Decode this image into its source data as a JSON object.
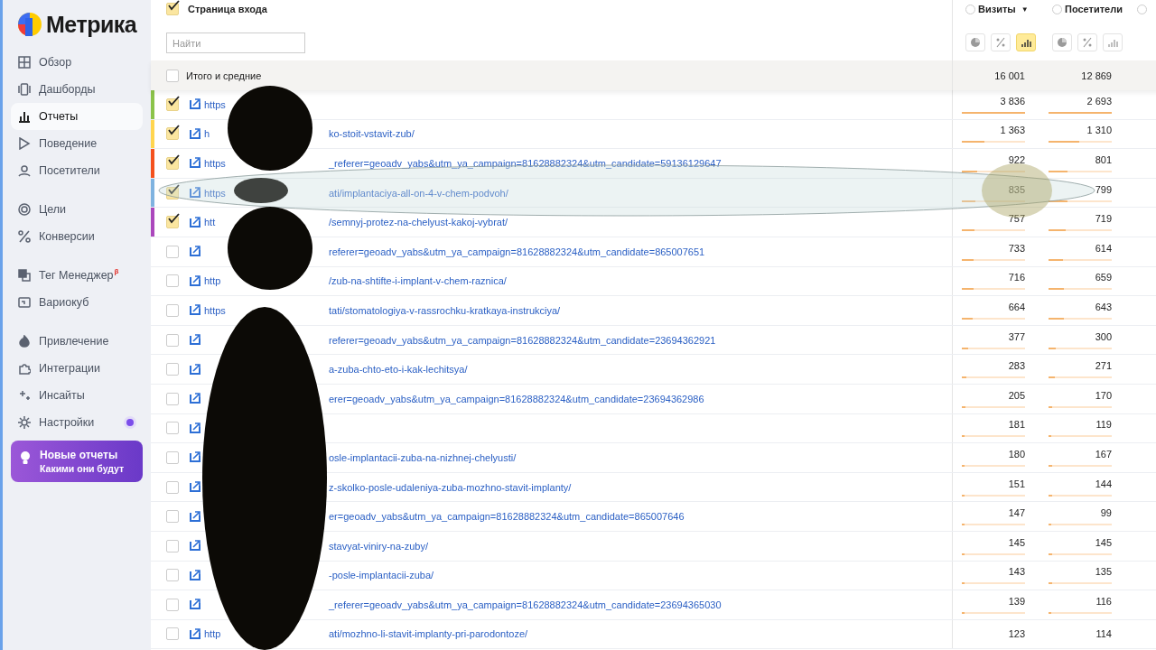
{
  "sidebar": {
    "logo_text": "Метрика",
    "groups": [
      [
        {
          "label": "Обзор",
          "selected": false,
          "notification": false
        },
        {
          "label": "Дашборды",
          "selected": false,
          "notification": false
        },
        {
          "label": "Отчеты",
          "selected": true,
          "notification": false
        },
        {
          "label": "Поведение",
          "selected": false,
          "notification": false
        },
        {
          "label": "Посетители",
          "selected": false,
          "notification": false
        }
      ],
      [
        {
          "label": "Цели",
          "selected": false,
          "notification": false
        },
        {
          "label": "Конверсии",
          "selected": false,
          "notification": false
        }
      ],
      [
        {
          "label": "Тег Менеджер",
          "badge": "β",
          "selected": false,
          "notification": false
        },
        {
          "label": "Вариокуб",
          "selected": false,
          "notification": false
        }
      ],
      [
        {
          "label": "Привлечение",
          "selected": false,
          "notification": false
        },
        {
          "label": "Интеграции",
          "selected": false,
          "notification": false
        },
        {
          "label": "Инсайты",
          "selected": false,
          "notification": false
        },
        {
          "label": "Настройки",
          "selected": false,
          "notification": true
        }
      ]
    ],
    "promo": {
      "title": "Новые отчеты",
      "subtitle": "Какими они будут"
    }
  },
  "report": {
    "dimension": {
      "label": "Страница входа",
      "checked": true
    },
    "search": {
      "placeholder": "Найти"
    },
    "columns": [
      {
        "label": "Визиты",
        "sort_mark": "▼",
        "views": [
          {
            "selected": false
          },
          {
            "selected": false
          },
          {
            "selected": true
          }
        ]
      },
      {
        "label": "Посетители",
        "views": [
          {
            "selected": false
          },
          {
            "selected": false
          },
          {
            "selected": false
          }
        ]
      }
    ],
    "totals": {
      "label": "Итого и средние",
      "checked": false,
      "values": [
        "16 001",
        "12 869"
      ]
    },
    "rows": [
      {
        "checked": true,
        "color": "#8bc34a",
        "url_prefix": "https",
        "url_suffix": "",
        "visits": {
          "value": "3 836",
          "level": 1
        },
        "visitors": {
          "value": "2 693",
          "level": 1
        }
      },
      {
        "checked": true,
        "color": "#ffd54f",
        "url_prefix": "h",
        "url_suffix": "ko-stoit-vstavit-zub/",
        "visits": {
          "value": "1 363",
          "level": 0.355
        },
        "visitors": {
          "value": "1 310",
          "level": 0.486
        }
      },
      {
        "checked": true,
        "color": "#f4511e",
        "url_prefix": "https",
        "url_suffix": "_referer=geoadv_yabs&utm_ya_campaign=81628882324&utm_candidate=59136129647",
        "visits": {
          "value": "922",
          "level": 0.24
        },
        "visitors": {
          "value": "801",
          "level": 0.297
        }
      },
      {
        "checked": true,
        "color": "#7fb3e0",
        "url_prefix": "https",
        "url_suffix": "ati/implantaciya-all-on-4-v-chem-podvoh/",
        "visits": {
          "value": "835",
          "level": 0.218
        },
        "visitors": {
          "value": "799",
          "level": 0.297
        }
      },
      {
        "checked": true,
        "color": "#ab47bc",
        "url_prefix": "htt",
        "url_suffix": "/semnyj-protez-na-chelyust-kakoj-vybrat/",
        "visits": {
          "value": "757",
          "level": 0.197
        },
        "visitors": {
          "value": "719",
          "level": 0.267
        }
      },
      {
        "checked": false,
        "url_prefix": "",
        "url_suffix": "referer=geoadv_yabs&utm_ya_campaign=81628882324&utm_candidate=865007651",
        "visits": {
          "value": "733",
          "level": 0.191
        },
        "visitors": {
          "value": "614",
          "level": 0.228
        }
      },
      {
        "checked": false,
        "url_prefix": "http",
        "url_suffix": "/zub-na-shtifte-i-implant-v-chem-raznica/",
        "visits": {
          "value": "716",
          "level": 0.187
        },
        "visitors": {
          "value": "659",
          "level": 0.245
        }
      },
      {
        "checked": false,
        "url_prefix": "https",
        "url_suffix": "tati/stomatologiya-v-rassrochku-kratkaya-instrukciya/",
        "visits": {
          "value": "664",
          "level": 0.173
        },
        "visitors": {
          "value": "643",
          "level": 0.239
        }
      },
      {
        "checked": false,
        "url_prefix": "",
        "url_suffix": "referer=geoadv_yabs&utm_ya_campaign=81628882324&utm_candidate=23694362921",
        "visits": {
          "value": "377",
          "level": 0.098
        },
        "visitors": {
          "value": "300",
          "level": 0.111
        }
      },
      {
        "checked": false,
        "url_prefix": "",
        "url_suffix": "a-zuba-chto-eto-i-kak-lechitsya/",
        "visits": {
          "value": "283",
          "level": 0.074
        },
        "visitors": {
          "value": "271",
          "level": 0.101
        }
      },
      {
        "checked": false,
        "url_prefix": "",
        "url_suffix": "erer=geoadv_yabs&utm_ya_campaign=81628882324&utm_candidate=23694362986",
        "visits": {
          "value": "205",
          "level": 0.053
        },
        "visitors": {
          "value": "170",
          "level": 0.063
        }
      },
      {
        "checked": false,
        "url_prefix": "",
        "url_suffix": "",
        "visits": {
          "value": "181",
          "level": 0.047
        },
        "visitors": {
          "value": "119",
          "level": 0.044
        }
      },
      {
        "checked": false,
        "url_prefix": "",
        "url_suffix": "osle-implantacii-zuba-na-nizhnej-chelyusti/",
        "visits": {
          "value": "180",
          "level": 0.047
        },
        "visitors": {
          "value": "167",
          "level": 0.062
        }
      },
      {
        "checked": false,
        "url_prefix": "",
        "url_suffix": "z-skolko-posle-udaleniya-zuba-mozhno-stavit-implanty/",
        "visits": {
          "value": "151",
          "level": 0.039
        },
        "visitors": {
          "value": "144",
          "level": 0.053
        }
      },
      {
        "checked": false,
        "url_prefix": "",
        "url_suffix": "er=geoadv_yabs&utm_ya_campaign=81628882324&utm_candidate=865007646",
        "visits": {
          "value": "147",
          "level": 0.038
        },
        "visitors": {
          "value": "99",
          "level": 0.037
        }
      },
      {
        "checked": false,
        "url_prefix": "",
        "url_suffix": "stavyat-viniry-na-zuby/",
        "visits": {
          "value": "145",
          "level": 0.038
        },
        "visitors": {
          "value": "145",
          "level": 0.054
        }
      },
      {
        "checked": false,
        "url_prefix": "",
        "url_suffix": "-posle-implantacii-zuba/",
        "visits": {
          "value": "143",
          "level": 0.037
        },
        "visitors": {
          "value": "135",
          "level": 0.05
        }
      },
      {
        "checked": false,
        "url_prefix": "",
        "url_suffix": "_referer=geoadv_yabs&utm_ya_campaign=81628882324&utm_candidate=23694365030",
        "visits": {
          "value": "139",
          "level": 0.036
        },
        "visitors": {
          "value": "116",
          "level": 0.043
        }
      },
      {
        "checked": false,
        "url_prefix": "http",
        "url_suffix": "ati/mozhno-li-stavit-implanty-pri-parodontoze/",
        "visits": {
          "value": "123"
        },
        "visitors": {
          "value": "114"
        }
      }
    ]
  }
}
